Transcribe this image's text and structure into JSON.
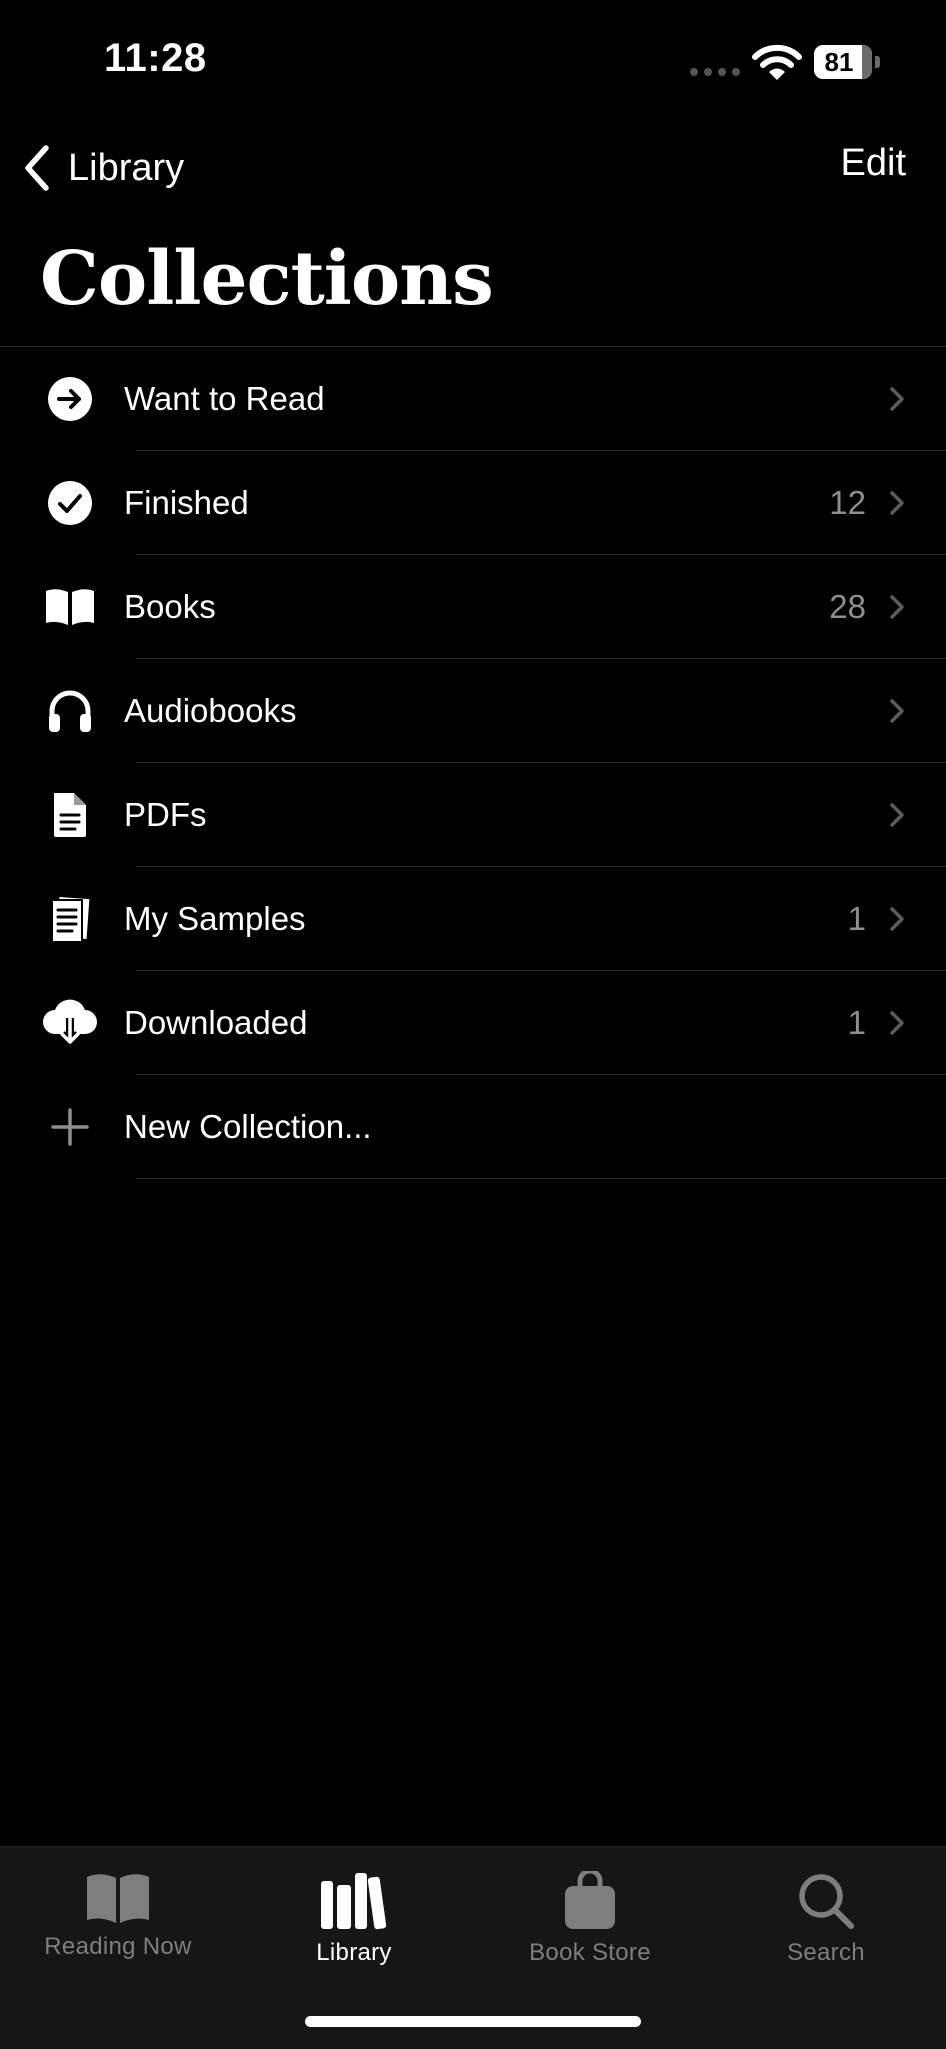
{
  "status_bar": {
    "time": "11:28",
    "battery_percent": "81",
    "signal_icon": "cellular-dots-icon",
    "wifi_icon": "wifi-icon"
  },
  "nav": {
    "back_label": "Library",
    "edit_label": "Edit"
  },
  "page_title": "Collections",
  "collections": [
    {
      "label": "Want to Read",
      "count": "",
      "icon": "arrow-circle-icon"
    },
    {
      "label": "Finished",
      "count": "12",
      "icon": "checkmark-circle-icon"
    },
    {
      "label": "Books",
      "count": "28",
      "icon": "open-book-icon"
    },
    {
      "label": "Audiobooks",
      "count": "",
      "icon": "headphones-icon"
    },
    {
      "label": "PDFs",
      "count": "",
      "icon": "document-icon"
    },
    {
      "label": "My Samples",
      "count": "1",
      "icon": "samples-icon"
    },
    {
      "label": "Downloaded",
      "count": "1",
      "icon": "cloud-download-icon"
    },
    {
      "label": "New Collection...",
      "count": "",
      "icon": "plus-icon"
    }
  ],
  "tab_bar": {
    "selected": "Library",
    "tabs": [
      {
        "label": "Reading Now",
        "icon": "book-icon"
      },
      {
        "label": "Library",
        "icon": "library-icon"
      },
      {
        "label": "Book Store",
        "icon": "shopping-bag-icon"
      },
      {
        "label": "Search",
        "icon": "search-icon"
      }
    ]
  },
  "colors": {
    "background": "#000000",
    "secondary_text": "#8e8e93",
    "separator": "#2a2a2a",
    "tab_bar_bg": "#161616"
  }
}
